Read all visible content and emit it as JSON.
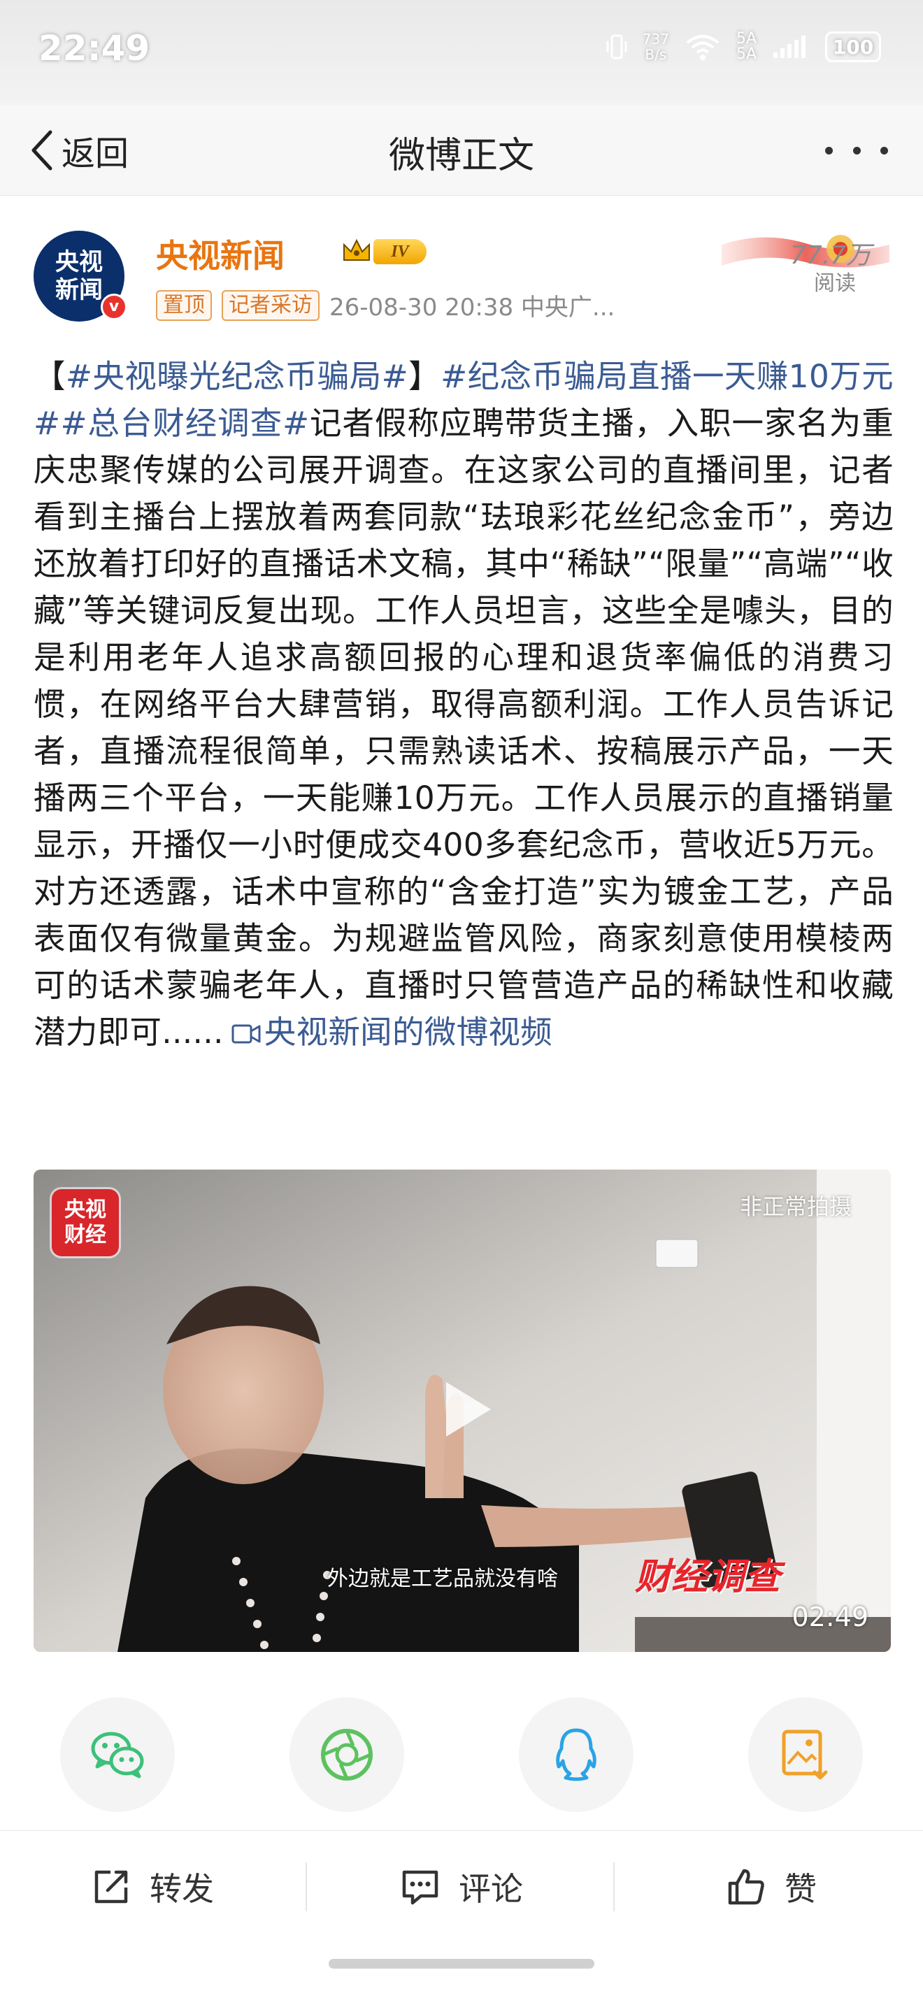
{
  "status_bar": {
    "time": "22:49",
    "net_speed_value": "737",
    "net_speed_unit": "B/s",
    "signal_label_1": "5A",
    "signal_label_2": "5A",
    "battery": "100"
  },
  "nav": {
    "back_label": "返回",
    "title": "微博正文"
  },
  "author": {
    "avatar_line1": "央视",
    "avatar_line2": "新闻",
    "name": "央视新闻",
    "level": "IV",
    "tags": [
      "置顶",
      "记者采访"
    ],
    "meta": "26-08-30 20:38  中央广...",
    "reads_count": "77.7万",
    "reads_label": "阅读"
  },
  "post": {
    "segments": [
      {
        "text": "【",
        "type": "text"
      },
      {
        "text": "#央视曝光纪念币骗局#",
        "type": "link"
      },
      {
        "text": "】",
        "type": "text"
      },
      {
        "text": "#纪念币骗局直播一天赚10万元#",
        "type": "link"
      },
      {
        "text": "#总台财经调查#",
        "type": "link"
      },
      {
        "text": "记者假称应聘带货主播，入职一家名为重庆忠聚传媒的公司展开调查。在这家公司的直播间里，记者看到主播台上摆放着两套同款“珐琅彩花丝纪念金币”，旁边还放着打印好的直播话术文稿，其中“稀缺”“限量”“高端”“收藏”等关键词反复出现。工作人员坦言，这些全是噱头，目的是利用老年人追求高额回报的心理和退货率偏低的消费习惯，在网络平台大肆营销，取得高额利润。工作人员告诉记者，直播流程很简单，只需熟读话术、按稿展示产品，一天播两三个平台，一天能赚10万元。工作人员展示的直播销量显示，开播仅一小时便成交400多套纪念币，营收近5万元。对方还透露，话术中宣称的“含金打造”实为镀金工艺，产品表面仅有微量黄金。为规避监管风险，商家刻意使用模棱两可的话术蒙骗老年人，直播时只管营造产品的稀缺性和收藏潜力即可......",
        "type": "text"
      }
    ],
    "video_link_label": "央视新闻的微博视频"
  },
  "video": {
    "logo_line1": "央视",
    "logo_line2": "财经",
    "watermark": "非正常拍摄",
    "subtitle": "外边就是工艺品就没有啥",
    "brand": "财经调查",
    "duration": "02:49"
  },
  "share": {
    "icons": [
      "wechat-icon",
      "moments-icon",
      "qq-icon",
      "save-image-icon"
    ],
    "colors": {
      "wechat": "#3cc07a",
      "moments": "#5cc25f",
      "qq": "#29a3e6",
      "save": "#f0a12a"
    }
  },
  "actions": {
    "repost_label": "转发",
    "comment_label": "评论",
    "like_label": "赞"
  },
  "colors": {
    "author_name": "#e87511",
    "link": "#3b5b93",
    "brand_red": "#e8242b"
  }
}
